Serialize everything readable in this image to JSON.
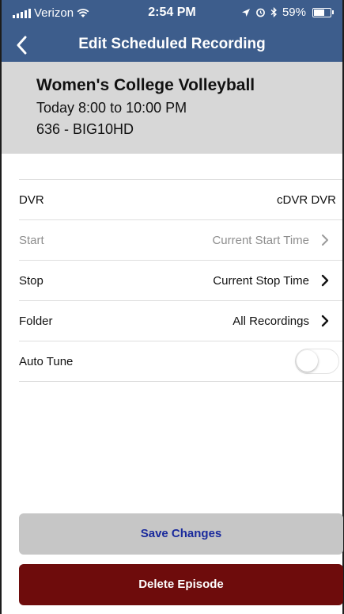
{
  "status_bar": {
    "carrier": "Verizon",
    "time": "2:54 PM",
    "battery": "59%"
  },
  "nav": {
    "title": "Edit Scheduled Recording"
  },
  "program": {
    "title": "Women's College Volleyball",
    "time": "Today 8:00 to 10:00 PM",
    "channel": "636 - BIG10HD"
  },
  "settings": {
    "dvr": {
      "label": "DVR",
      "value": "cDVR DVR"
    },
    "start": {
      "label": "Start",
      "value": "Current Start Time"
    },
    "stop": {
      "label": "Stop",
      "value": "Current Stop Time"
    },
    "folder": {
      "label": "Folder",
      "value": "All Recordings"
    },
    "auto_tune": {
      "label": "Auto Tune",
      "enabled": false
    }
  },
  "buttons": {
    "save": "Save Changes",
    "delete": "Delete Episode"
  },
  "colors": {
    "nav_bar": "#3d5d8c",
    "program_bg": "#d7d7d7",
    "save_bg": "#c6c6c6",
    "save_text": "#1a2a9c",
    "delete_bg": "#6e0c0c"
  }
}
